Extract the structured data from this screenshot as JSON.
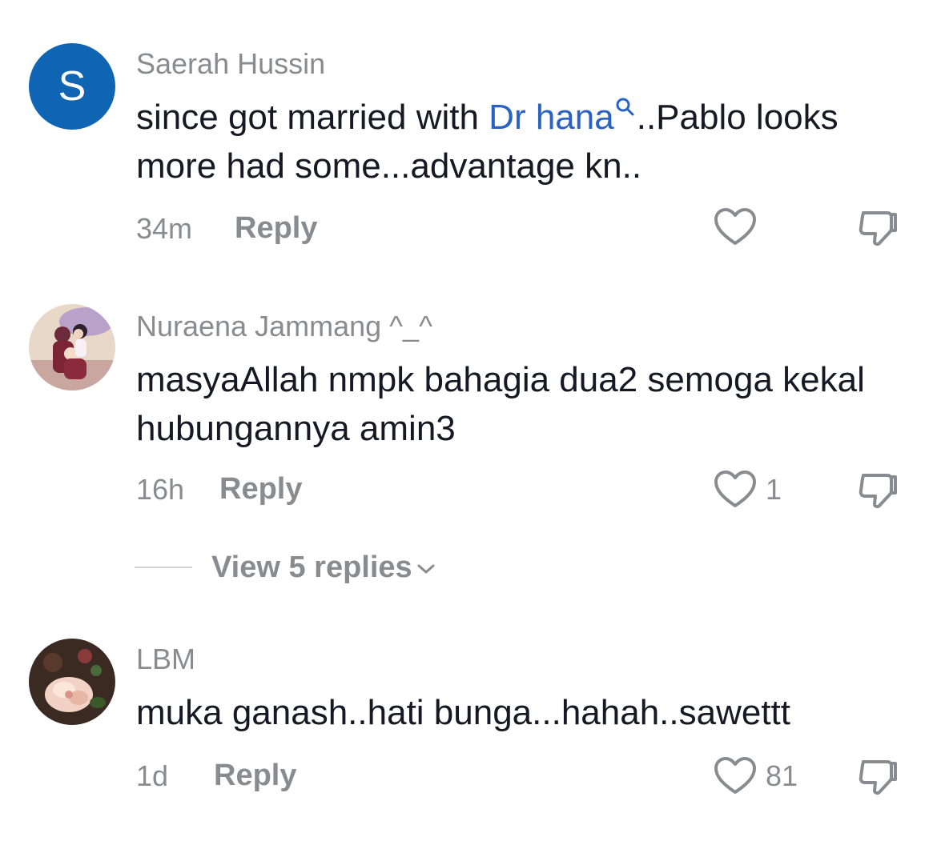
{
  "comments": [
    {
      "avatar_letter": "S",
      "username": "Saerah Hussin",
      "text_before": "since got married with ",
      "mention": "Dr hana",
      "text_after": "..Pablo looks more had some...advantage kn..",
      "time": "34m",
      "reply_label": "Reply",
      "like_count": ""
    },
    {
      "username": "Nuraena Jammang ^_^",
      "text": "masyaAllah nmpk bahagia dua2 semoga kekal hubungannya amin3",
      "time": "16h",
      "reply_label": "Reply",
      "like_count": "1"
    },
    {
      "username": "LBM",
      "text": "muka ganash..hati bunga...hahah..sawettt",
      "time": "1d",
      "reply_label": "Reply",
      "like_count": "81"
    }
  ],
  "view_replies_label": "View 5 replies",
  "icons": {
    "like": "heart-outline-icon",
    "dislike": "thumbs-down-outline-icon",
    "mention": "search-icon",
    "expand": "chevron-down-icon"
  },
  "colors": {
    "avatar_bg": "#0f64b4",
    "mention": "#2a62c4",
    "muted": "#8a8b91",
    "text": "#161823"
  }
}
